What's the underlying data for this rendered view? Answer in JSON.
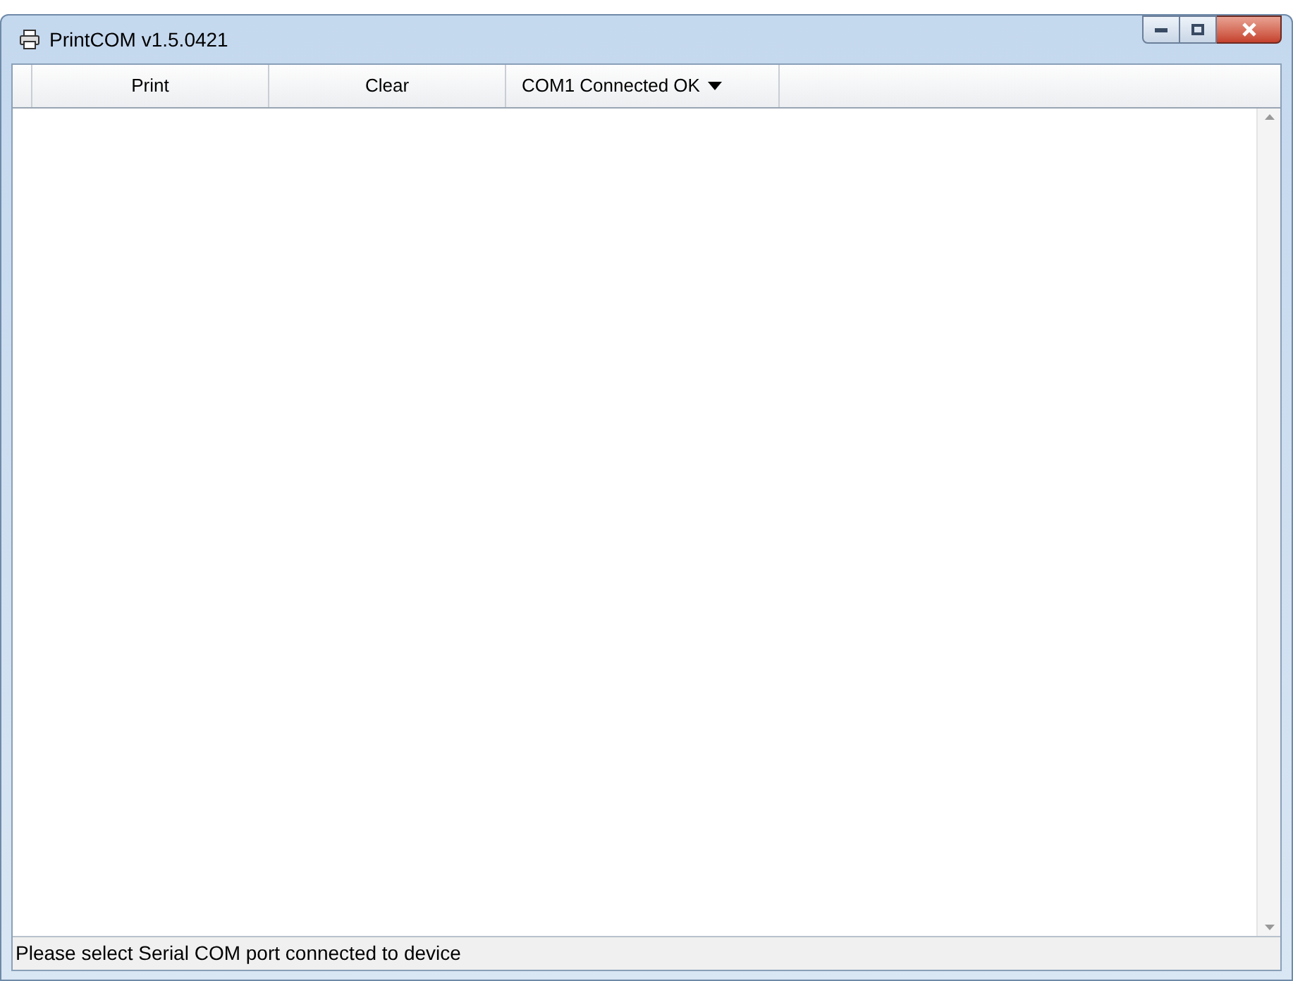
{
  "window": {
    "title": "PrintCOM v1.5.0421"
  },
  "toolbar": [
    {
      "kind": "button",
      "label": "Print"
    },
    {
      "kind": "button",
      "label": "Clear"
    },
    {
      "kind": "dropdown",
      "label": "COM1 Connected OK"
    }
  ],
  "status_bar": "Please select Serial COM port connected to device"
}
